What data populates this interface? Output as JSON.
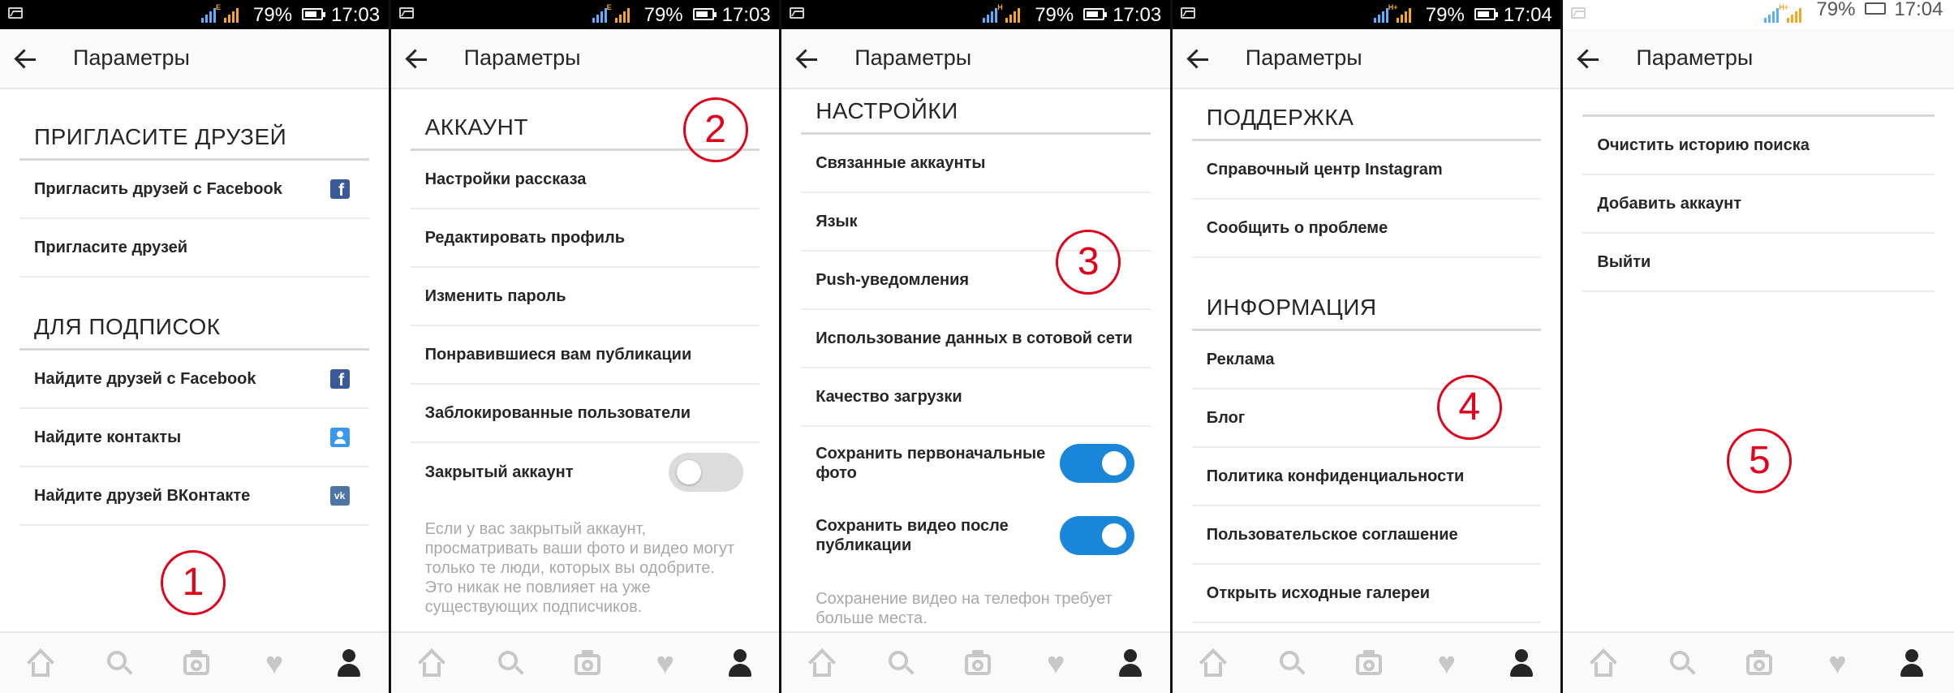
{
  "colors": {
    "accent_toggle": "#1a86d9",
    "annotation_red": "#e2001a",
    "facebook": "#3b5998",
    "vk": "#4c75a3",
    "contact": "#3897f0"
  },
  "screens": [
    {
      "status": {
        "battery": "79%",
        "time": "17:03",
        "network": "E"
      },
      "title": "Параметры",
      "sections": [
        {
          "title": "ПРИГЛАСИТЕ ДРУЗЕЙ"
        },
        {
          "title": "ДЛЯ ПОДПИСОК"
        }
      ],
      "items": [
        {
          "label": "Пригласить друзей с Facebook",
          "icon": "facebook-icon"
        },
        {
          "label": "Пригласите друзей"
        },
        {
          "label": "Найдите друзей с Facebook",
          "icon": "facebook-icon"
        },
        {
          "label": "Найдите контакты",
          "icon": "contacts-icon"
        },
        {
          "label": "Найдите друзей ВКонтакте",
          "icon": "vk-icon"
        }
      ],
      "marker": "1"
    },
    {
      "status": {
        "battery": "79%",
        "time": "17:03",
        "network": "E"
      },
      "title": "Параметры",
      "sections": [
        {
          "title": "АККАУНТ"
        }
      ],
      "items": [
        {
          "label": "Настройки рассказа"
        },
        {
          "label": "Редактировать профиль"
        },
        {
          "label": "Изменить пароль"
        },
        {
          "label": "Понравившиеся вам публикации"
        },
        {
          "label": "Заблокированные пользователи"
        },
        {
          "label": "Закрытый аккаунт",
          "toggle": "off"
        }
      ],
      "note": "Если у вас закрытый аккаунт, просматривать ваши фото и видео могут только те люди, которых вы одобрите. Это никак не повлияет на уже существующих подписчиков.",
      "marker": "2"
    },
    {
      "status": {
        "battery": "79%",
        "time": "17:03",
        "network": "H"
      },
      "title": "Параметры",
      "sections": [
        {
          "title": "НАСТРОЙКИ"
        }
      ],
      "items": [
        {
          "label": "Связанные аккаунты"
        },
        {
          "label": "Язык"
        },
        {
          "label": "Push-уведомления"
        },
        {
          "label": "Использование данных в сотовой сети"
        },
        {
          "label": "Качество загрузки"
        },
        {
          "label": "Сохранить первоначальные фото",
          "toggle": "on"
        },
        {
          "label": "Сохранить видео после публикации",
          "toggle": "on"
        }
      ],
      "note": "Сохранение видео на телефон требует больше места.",
      "marker": "3"
    },
    {
      "status": {
        "battery": "79%",
        "time": "17:04",
        "network": "H+"
      },
      "title": "Параметры",
      "sections": [
        {
          "title": "ПОДДЕРЖКА"
        },
        {
          "title": "ИНФОРМАЦИЯ"
        }
      ],
      "items": [
        {
          "label": "Справочный центр Instagram"
        },
        {
          "label": "Сообщить о проблеме"
        },
        {
          "label": "Реклама"
        },
        {
          "label": "Блог"
        },
        {
          "label": "Политика конфиденциальности"
        },
        {
          "label": "Пользовательское соглашение"
        },
        {
          "label": "Открыть исходные галереи"
        }
      ],
      "marker": "4"
    },
    {
      "status": {
        "battery": "79%",
        "time": "17:04",
        "network": "H+"
      },
      "title": "Параметры",
      "sections": [],
      "items": [
        {
          "label": "Очистить историю поиска"
        },
        {
          "label": "Добавить аккаунт"
        },
        {
          "label": "Выйти"
        }
      ],
      "marker": "5"
    }
  ],
  "navbar": [
    "home-icon",
    "search-icon",
    "camera-icon",
    "heart-icon",
    "profile-icon"
  ]
}
